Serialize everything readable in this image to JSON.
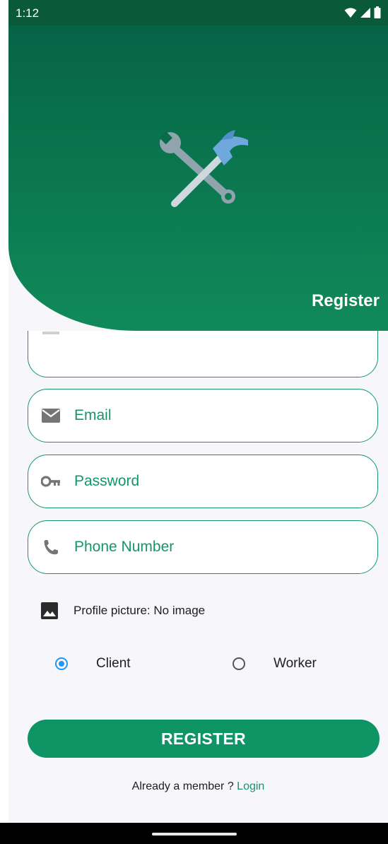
{
  "status_bar": {
    "time": "1:12"
  },
  "header": {
    "title": "Register"
  },
  "form": {
    "fields": [
      {
        "name": "email-field",
        "placeholder": "Email",
        "icon": "mail-icon"
      },
      {
        "name": "password-field",
        "placeholder": "Password",
        "icon": "key-icon"
      },
      {
        "name": "phone-field",
        "placeholder": "Phone Number",
        "icon": "phone-icon"
      }
    ],
    "profile_picture_label": "Profile picture: No image",
    "role_options": [
      {
        "label": "Client",
        "selected": true
      },
      {
        "label": "Worker",
        "selected": false
      }
    ],
    "register_button": "REGISTER"
  },
  "footer": {
    "prompt": "Already a member ? ",
    "login_link": "Login"
  },
  "colors": {
    "primary": "#0e9465",
    "header_dark": "#066446",
    "radio_selected": "#2196f3"
  }
}
